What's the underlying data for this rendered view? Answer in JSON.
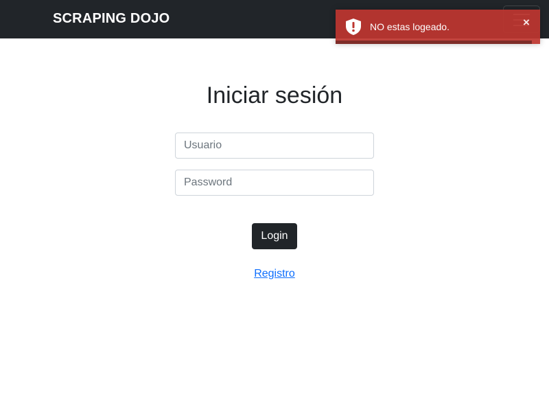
{
  "navbar": {
    "brand": "SCRAPING DOJO",
    "toggler_icon": "hamburger-menu-icon",
    "background": "#212529"
  },
  "toast": {
    "icon": "shield-exclamation-icon",
    "message": "NO estas logeado.",
    "close_label": "×",
    "background": "#bd362f",
    "progress": 0.96
  },
  "login": {
    "title": "Iniciar sesión",
    "username_placeholder": "Usuario",
    "username_value": "",
    "password_placeholder": "Password",
    "password_value": "",
    "submit_label": "Login",
    "register_label": "Registro"
  },
  "colors": {
    "button": "#212529",
    "link": "#0d6efd"
  }
}
